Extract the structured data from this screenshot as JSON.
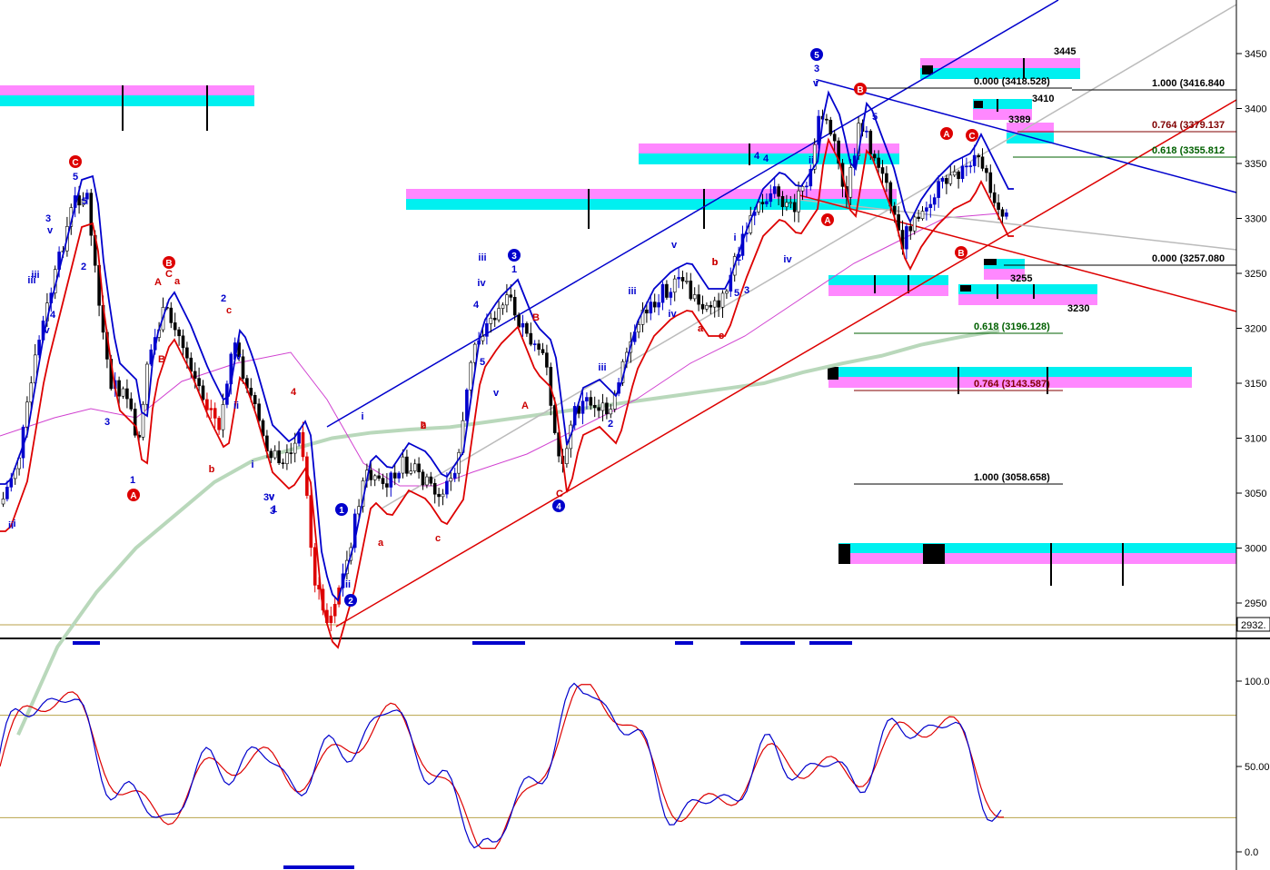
{
  "chart_data": {
    "type": "candlestick",
    "price_panel": {
      "y_ticks": [
        3450,
        3400,
        3350,
        3300,
        3250,
        3200,
        3150,
        3100,
        3050,
        3000,
        2950
      ],
      "ylim": [
        2915,
        3465
      ],
      "last_price_label": "2932.",
      "moving_average_100": [
        2830,
        2910,
        2960,
        3000,
        3030,
        3060,
        3080,
        3090,
        3100,
        3105,
        3108,
        3110,
        3115,
        3120,
        3125,
        3130,
        3135,
        3140,
        3145,
        3150,
        3160,
        3168,
        3175,
        3185,
        3192,
        3198
      ],
      "fibonacci_levels": [
        {
          "label": "0.000 (3418.528)",
          "value": 3418.528
        },
        {
          "label": "1.000 (3416.840",
          "value": 3416.84
        },
        {
          "label": "0.764 (3379.137",
          "value": 3379.137
        },
        {
          "label": "0.618 (3355.812",
          "value": 3355.812
        },
        {
          "label": "0.000 (3257.080",
          "value": 3257.08
        },
        {
          "label": "0.618 (3196.128)",
          "value": 3196.128
        },
        {
          "label": "0.764 (3143.587)",
          "value": 3143.587
        },
        {
          "label": "1.000 (3058.658)",
          "value": 3058.658
        }
      ],
      "target_labels": [
        "3445",
        "3410",
        "3389",
        "3255",
        "3230"
      ],
      "wave_labels": {
        "circled_blue": [
          "5",
          "3",
          "1",
          "2",
          "4"
        ],
        "circled_red": [
          "C",
          "B",
          "A",
          "B",
          "A",
          "A",
          "C",
          "B"
        ],
        "blue_text": [
          "5",
          "3",
          "v",
          "iii",
          "iv",
          "4",
          "3",
          "5",
          "1",
          "2",
          "i",
          "ii",
          "iii",
          "iv",
          "v",
          "3",
          "1",
          "2",
          "i",
          "ii",
          "3",
          "v",
          "iii",
          "iv",
          "4",
          "5",
          "v",
          "1",
          "i",
          "ii",
          "iii",
          "2",
          "iii",
          "iv",
          "v",
          "3",
          "i",
          "ii",
          "4",
          "5",
          "iv",
          "v",
          "i",
          "2",
          "3",
          "4",
          "5"
        ],
        "red_text": [
          "A",
          "C",
          "a",
          "B",
          "b",
          "c",
          "b",
          "a",
          "c",
          "2",
          "a",
          "b",
          "c",
          "4",
          "B",
          "A",
          "C",
          "b",
          "c",
          "a"
        ]
      }
    },
    "oscillator_panel": {
      "type": "stochastic",
      "y_ticks": [
        "100.0",
        "50.00",
        "0.0"
      ],
      "ylim": [
        0,
        100
      ],
      "levels": [
        80,
        20
      ]
    }
  }
}
